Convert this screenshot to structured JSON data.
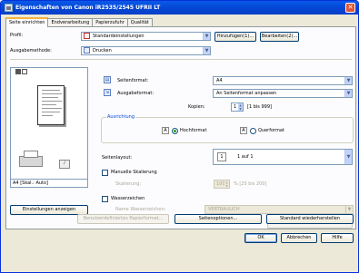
{
  "window": {
    "title": "Eigenschaften von Canon iR2535/2545 UFRII LT",
    "close_glyph": "✕"
  },
  "tabs": [
    {
      "label": "Seite einrichten",
      "active": true
    },
    {
      "label": "Endverarbeitung"
    },
    {
      "label": "Papierzufuhr"
    },
    {
      "label": "Qualität"
    }
  ],
  "profile": {
    "label": "Profil:",
    "value": "Standardeinstellungen",
    "add_btn": "Hinzufügen(1)...",
    "edit_btn": "Bearbeiten(2)..."
  },
  "output_method": {
    "label": "Ausgabemethode:",
    "value": "Drucken"
  },
  "preview": {
    "footer": "A4 [Skal.: Auto]"
  },
  "page_size": {
    "label": "Seitenformat:",
    "value": "A4"
  },
  "output_size": {
    "label": "Ausgabeformat:",
    "value": "An Seitenformat anpassen"
  },
  "copies": {
    "label": "Kopien:",
    "value": "1",
    "range": "[1 bis 999]"
  },
  "orientation": {
    "group_title": "Ausrichtung",
    "portrait": "Hochformat",
    "landscape": "Querformat",
    "selected": "portrait"
  },
  "page_layout": {
    "label": "Seitenlayout:",
    "value": "1 auf 1"
  },
  "manual_scaling": {
    "label": "Manuelle Skalierung",
    "checked": false,
    "scaling_label": "Skalierung:",
    "scaling_value": "100",
    "scaling_range": "% [25 bis 200]"
  },
  "watermark": {
    "label": "Wasserzeichen",
    "checked": false,
    "name_label": "Name Wasserzeichen:",
    "name_value": "VERTRAULICH",
    "edit_btn": "Wasserzeichen bearbeiten..."
  },
  "settings_view_btn": "Einstellungen anzeigen",
  "bottom_buttons": {
    "custom_paper": "Benutzerdefiniertes Papierformat...",
    "page_options": "Seitenoptionen...",
    "restore_defaults": "Standard wiederherstellen"
  },
  "dialog_buttons": {
    "ok": "OK",
    "cancel": "Abbrechen",
    "help": "Hilfe"
  }
}
